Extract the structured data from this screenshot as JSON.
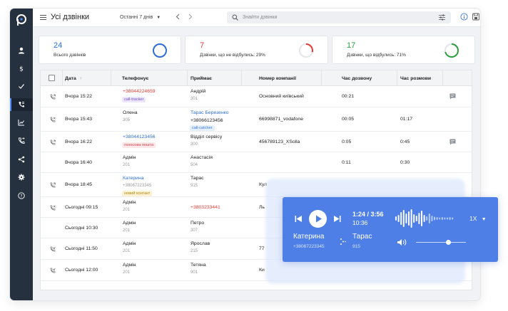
{
  "header": {
    "title": "Усі дзвінки",
    "period": "Останні 7 днів",
    "search_placeholder": "Знайти дзвінки"
  },
  "kpis": [
    {
      "value": "24",
      "label": "Всього дзвінків",
      "color": "#2f6fd6",
      "fraction": 1.0
    },
    {
      "value": "7",
      "label": "Дзвінки, що не відбулись: 29%",
      "color": "#e53935",
      "fraction": 0.29
    },
    {
      "value": "17",
      "label": "Дзвінки, що відбулись: 71%",
      "color": "#2e9e3f",
      "fraction": 0.71
    }
  ],
  "table": {
    "columns": [
      "Дата",
      "Телефонує",
      "Приймає",
      "Номер компанії",
      "Час дозвону",
      "Час розмови"
    ],
    "rows": [
      {
        "dir": "in-ok",
        "date": "Вчора 15:22",
        "caller": "+38044224659",
        "caller_style": "red",
        "caller_sub": "",
        "caller_tag": "call-tracker",
        "caller_tag_style": "purple",
        "receiver": "Андрій",
        "receiver_style": "",
        "receiver_sub": "301",
        "receiver_tag": "",
        "receiver_tag_style": "",
        "company": "Основний київський",
        "wait": "00:21",
        "talk": "",
        "note": true
      },
      {
        "dir": "missed",
        "date": "Вчора 15:43",
        "caller": "Олена",
        "caller_style": "",
        "caller_sub": "305",
        "caller_tag": "",
        "caller_tag_style": "",
        "receiver": "Тарас Березенко",
        "receiver_style": "blue",
        "receiver_sub": "+38066123456",
        "receiver_tag": "call-catcher",
        "receiver_tag_style": "lblue",
        "company": "66998871_vodafone",
        "wait": "00:05",
        "talk": "01:17",
        "note": false
      },
      {
        "dir": "in-ok",
        "date": "Вчора 16:22",
        "caller": "+38044123456",
        "caller_style": "blue",
        "caller_sub": "",
        "caller_tag": "голосова пошта",
        "caller_tag_style": "pink",
        "receiver": "Відділ сервісу",
        "receiver_style": "",
        "receiver_sub": "300",
        "receiver_tag": "",
        "receiver_tag_style": "",
        "company": "456789123_XSolla",
        "wait": "0:05",
        "talk": "0:45",
        "note": true
      },
      {
        "dir": "",
        "date": "Вчора 16:40",
        "caller": "Адмін",
        "caller_style": "",
        "caller_sub": "201",
        "caller_tag": "",
        "caller_tag_style": "",
        "receiver": "Анастасія",
        "receiver_style": "",
        "receiver_sub": "504",
        "receiver_tag": "",
        "receiver_tag_style": "",
        "company": "",
        "wait": "0:11",
        "talk": "0:30",
        "note": false
      },
      {
        "dir": "in-ok",
        "date": "Вчора 18:45",
        "caller": "Катерина",
        "caller_style": "blue",
        "caller_sub": "+38067223345",
        "caller_tag": "новий контакт",
        "caller_tag_style": "yellow",
        "receiver": "Тарас",
        "receiver_style": "",
        "receiver_sub": "915",
        "receiver_tag": "",
        "receiver_tag_style": "",
        "company": "Кул",
        "wait": "",
        "talk": "",
        "note": false
      },
      {
        "dir": "missed",
        "date": "Сьогодні 09:15",
        "caller": "Адмін",
        "caller_style": "",
        "caller_sub": "201",
        "caller_tag": "",
        "caller_tag_style": "",
        "receiver": "+3803233441",
        "receiver_style": "red",
        "receiver_sub": "",
        "receiver_tag": "",
        "receiver_tag_style": "",
        "company": "Ль",
        "wait": "",
        "talk": "",
        "note": false
      },
      {
        "dir": "",
        "date": "Сьогодні 10:30",
        "caller": "Адмін",
        "caller_style": "",
        "caller_sub": "201",
        "caller_tag": "",
        "caller_tag_style": "",
        "receiver": "Петро",
        "receiver_style": "",
        "receiver_sub": "307",
        "receiver_tag": "",
        "receiver_tag_style": "",
        "company": "",
        "wait": "",
        "talk": "",
        "note": false
      },
      {
        "dir": "out",
        "date": "Сьогодні 11:50",
        "caller": "Адмін",
        "caller_style": "",
        "caller_sub": "201",
        "caller_tag": "",
        "caller_tag_style": "",
        "receiver": "Ярослав",
        "receiver_style": "",
        "receiver_sub": "215",
        "receiver_tag": "",
        "receiver_tag_style": "",
        "company": "77",
        "wait": "",
        "talk": "",
        "note": false
      },
      {
        "dir": "out",
        "date": "Сьогодні 12:00",
        "caller": "Адмін",
        "caller_style": "",
        "caller_sub": "201",
        "caller_tag": "",
        "caller_tag_style": "",
        "receiver": "Тетяна",
        "receiver_style": "",
        "receiver_sub": "901",
        "receiver_tag": "",
        "receiver_tag_style": "",
        "company": "Ки",
        "wait": "",
        "talk": "",
        "note": false
      }
    ]
  },
  "player": {
    "time": "1:24 / 3:56",
    "clock": "10:36",
    "speed": "1X",
    "progress": 0.36,
    "volume": 0.65,
    "caller_name": "Катерина",
    "caller_phone": "+38067223345",
    "receiver_name": "Тарас",
    "receiver_ext": "915"
  }
}
